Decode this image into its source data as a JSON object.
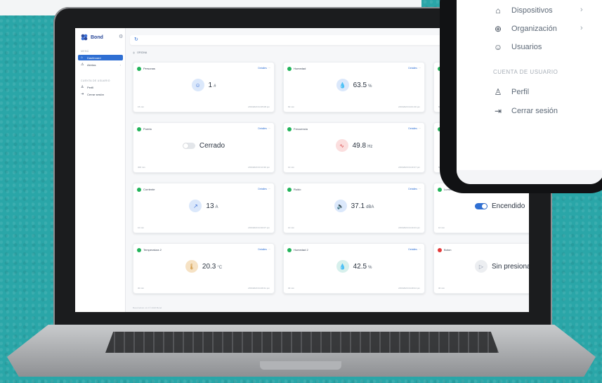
{
  "sidebar": {
    "brand": "Bond",
    "section_menu": "MENÚ",
    "items": [
      {
        "label": "Dashboard",
        "icon": "home-icon"
      },
      {
        "label": "Alertas",
        "icon": "alert-icon"
      }
    ],
    "section_account": "CUENTA DE USUARIO",
    "account_items": [
      {
        "label": "Perfil",
        "icon": "user-icon"
      },
      {
        "label": "Cerrar sesión",
        "icon": "logout-icon"
      }
    ]
  },
  "location": "OFICINA",
  "details_label": "Detalles",
  "cards": [
    {
      "name": "Personas",
      "value": "1",
      "unit": "#",
      "foot_left": "15 min",
      "foot_right": "2/03/2020 04:35:08 pm",
      "icon": "people-icon",
      "color": "#dbe8fb",
      "status": "green"
    },
    {
      "name": "Humedad",
      "value": "63.5",
      "unit": "%",
      "foot_left": "60 min",
      "foot_right": "2/03/2020 04:01:30 pm",
      "icon": "droplet-icon",
      "color": "#dbe8fb",
      "status": "green"
    },
    {
      "name": "Puerta",
      "value": "Cerrado",
      "unit": "",
      "foot_left": "300 min",
      "foot_right": "2/03/2020 03:13:30 pm",
      "icon": "toggle-off",
      "color": "#e3e6ea",
      "status": "green"
    },
    {
      "name": "Frecuencia",
      "value": "49.8",
      "unit": "Hz",
      "foot_left": "10 min",
      "foot_right": "2/03/2020 04:40:37 pm",
      "icon": "wave-icon",
      "color": "#fbdede",
      "status": "green"
    },
    {
      "name": "Corriente",
      "value": "13",
      "unit": "A",
      "foot_left": "10 min",
      "foot_right": "2/03/2020 04:30:07 pm",
      "icon": "trend-icon",
      "color": "#dbe8fb",
      "status": "green"
    },
    {
      "name": "Ruido",
      "value": "37.1",
      "unit": "dBA",
      "foot_left": "10 min",
      "foot_right": "2/03/2020 04:40:43 pm",
      "icon": "speaker-icon",
      "color": "#dbe8fb",
      "status": "green"
    },
    {
      "name": "Temperatura 2",
      "value": "20.3",
      "unit": "°C",
      "foot_left": "30 min",
      "foot_right": "2/03/2020 04:28:41 pm",
      "icon": "thermometer-icon",
      "color": "#f6e2c4",
      "status": "green"
    },
    {
      "name": "Humedad 2",
      "value": "42.5",
      "unit": "%",
      "foot_left": "30 min",
      "foot_right": "2/03/2020 04:28:44 pm",
      "icon": "droplet-icon",
      "color": "#d7f0ec",
      "status": "green"
    }
  ],
  "right_cards": [
    {
      "name": "Te",
      "value": "",
      "foot_left": "60"
    },
    {
      "name": "Vo",
      "value": "",
      "foot_left": "60"
    },
    {
      "name": "Luminosidad",
      "value": "Encendido",
      "foot_left": "10 min"
    },
    {
      "name": "Boton",
      "value": "Sin presionar",
      "foot_left": "30 min"
    }
  ],
  "footer": "Bond Admin v1.3 © 2020 Bond",
  "phone": {
    "items": [
      {
        "label": "Dispositivos",
        "icon": "device-icon",
        "chevron": "›"
      },
      {
        "label": "Organización",
        "icon": "globe-icon",
        "chevron": "›"
      },
      {
        "label": "Usuarios",
        "icon": "users-icon",
        "chevron": ""
      }
    ],
    "section": "CUENTA DE USUARIO",
    "account_items": [
      {
        "label": "Perfil",
        "icon": "user-icon"
      },
      {
        "label": "Cerrar sesión",
        "icon": "logout-icon"
      }
    ]
  }
}
